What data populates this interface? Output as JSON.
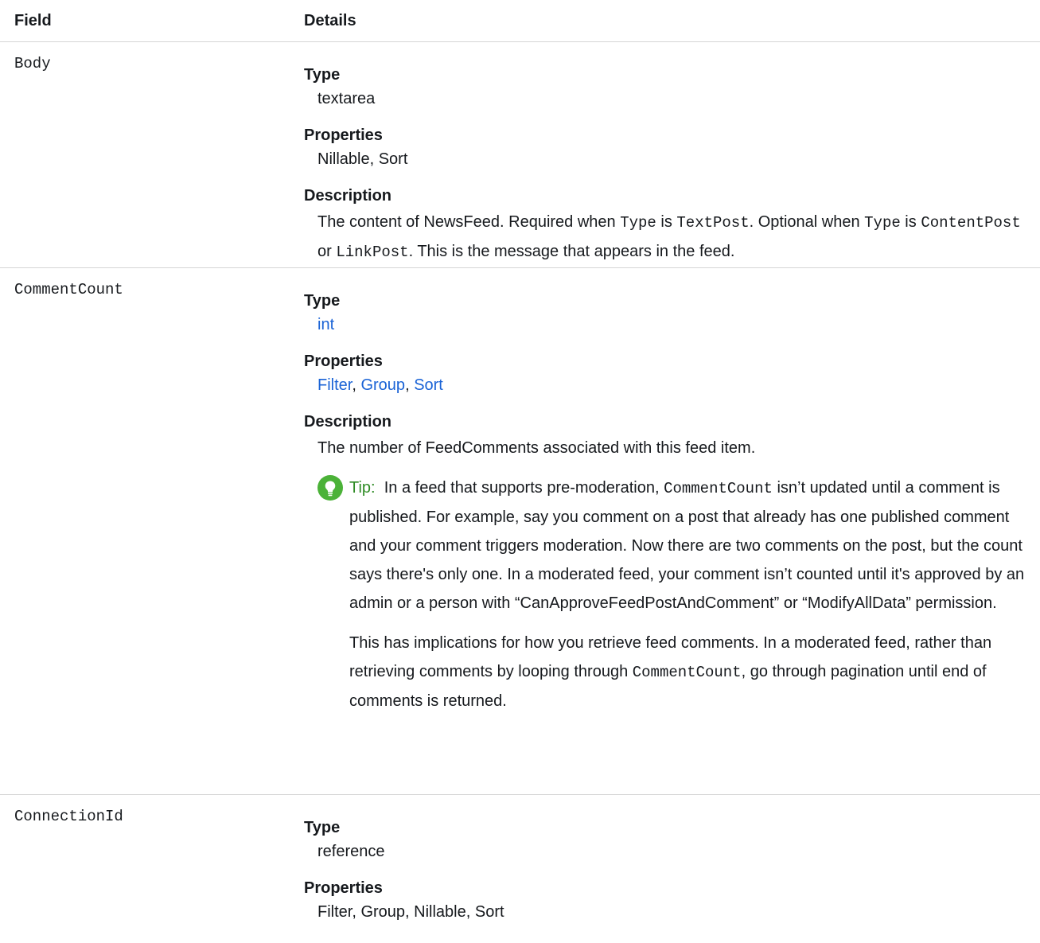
{
  "header": {
    "field": "Field",
    "details": "Details"
  },
  "rows": [
    {
      "field": "Body",
      "type_label": "Type",
      "type": "textarea",
      "properties_label": "Properties",
      "properties": "Nillable, Sort",
      "description_label": "Description",
      "description": {
        "t1": "The content of NewsFeed. Required when ",
        "c1": "Type",
        "t2": " is ",
        "c2": "TextPost",
        "t3": ". Optional when ",
        "c3": "Type",
        "t4": " is ",
        "c4": "ContentPost",
        "t5": " or ",
        "c5": "LinkPost",
        "t6": ". This is the message that appears in the feed."
      }
    },
    {
      "field": "CommentCount",
      "type_label": "Type",
      "type": "int",
      "properties_label": "Properties",
      "properties": [
        "Filter",
        "Group",
        "Sort"
      ],
      "properties_sep": ", ",
      "description_label": "Description",
      "description": "The number of FeedComments associated with this feed item.",
      "tip": {
        "icon": "lightbulb-icon",
        "label": "Tip:",
        "p1_a": "In a feed that supports pre-moderation, ",
        "p1_code": "CommentCount",
        "p1_b": " isn’t updated until a comment is published. For example, say you comment on a post that already has one published comment and your comment triggers moderation. Now there are two comments on the post, but the count says there's only one. In a moderated feed, your comment isn’t counted until it's approved by an admin or a person with “CanApproveFeedPostAndComment” or “ModifyAllData” permission.",
        "p2_a": "This has implications for how you retrieve feed comments. In a moderated feed, rather than retrieving comments by looping through ",
        "p2_code": "CommentCount",
        "p2_b": ", go through pagination until end of comments is returned."
      }
    },
    {
      "field": "ConnectionId",
      "type_label": "Type",
      "type": "reference",
      "properties_label": "Properties",
      "properties": "Filter, Group, Nillable, Sort"
    }
  ],
  "colors": {
    "link": "#1a63d6",
    "tip_icon": "#4bb238",
    "tip_label": "#2e8b24",
    "divider": "#d6d6d6"
  }
}
